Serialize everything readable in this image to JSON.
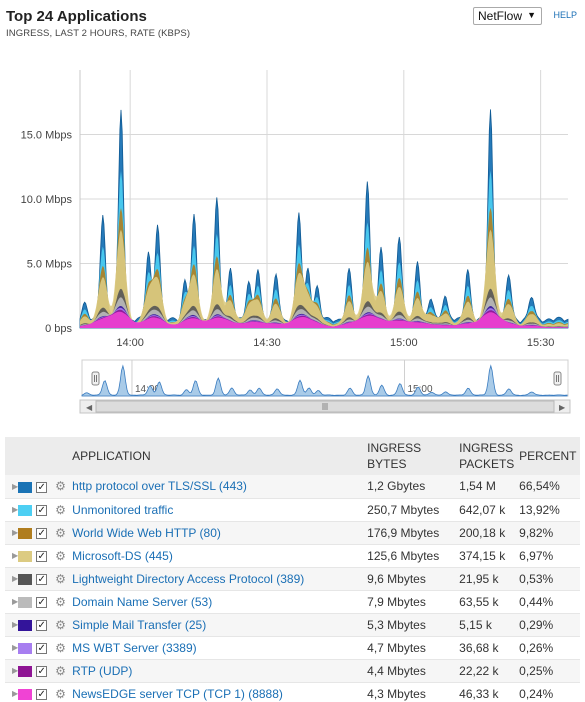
{
  "header": {
    "title": "Top 24 Applications",
    "subtitle": "INGRESS, LAST 2 HOURS, RATE (KBPS)",
    "help_label": "HELP",
    "source_select": {
      "value": "NetFlow"
    }
  },
  "chart_data": {
    "type": "area",
    "y_unit": "Mbps",
    "ylim": [
      0,
      20
    ],
    "y_ticks": [
      "0 bps",
      "5.0 Mbps",
      "10.0 Mbps",
      "15.0 Mbps"
    ],
    "x_ticks": [
      "14:00",
      "14:30",
      "15:00",
      "15:30"
    ],
    "x_range": [
      "13:49",
      "15:36"
    ],
    "grid": true,
    "spikes": [
      {
        "t": "13:50",
        "v": 1.2
      },
      {
        "t": "13:54",
        "v": 8.3
      },
      {
        "t": "13:58",
        "v": 16.2
      },
      {
        "t": "14:04",
        "v": 5.2
      },
      {
        "t": "14:06",
        "v": 7.5
      },
      {
        "t": "14:12",
        "v": 3.0
      },
      {
        "t": "14:14",
        "v": 8.0
      },
      {
        "t": "14:19",
        "v": 9.3
      },
      {
        "t": "14:22",
        "v": 4.0
      },
      {
        "t": "14:26",
        "v": 2.8
      },
      {
        "t": "14:28",
        "v": 4.0
      },
      {
        "t": "14:32",
        "v": 3.5
      },
      {
        "t": "14:37",
        "v": 8.3
      },
      {
        "t": "14:39",
        "v": 4.0
      },
      {
        "t": "14:41",
        "v": 2.5
      },
      {
        "t": "14:48",
        "v": 3.8
      },
      {
        "t": "14:52",
        "v": 10.8
      },
      {
        "t": "14:55",
        "v": 5.5
      },
      {
        "t": "14:59",
        "v": 6.5
      },
      {
        "t": "15:03",
        "v": 4.5
      },
      {
        "t": "15:06",
        "v": 1.6
      },
      {
        "t": "15:09",
        "v": 1.9
      },
      {
        "t": "15:14",
        "v": 4.0
      },
      {
        "t": "15:19",
        "v": 16.3
      },
      {
        "t": "15:23",
        "v": 3.5
      },
      {
        "t": "15:28",
        "v": 1.8
      }
    ]
  },
  "table": {
    "headers": {
      "application": "APPLICATION",
      "bytes": [
        "INGRESS",
        "BYTES"
      ],
      "packets": [
        "INGRESS",
        "PACKETS"
      ],
      "percent": "PERCENT"
    },
    "rows": [
      {
        "name": "http protocol over TLS/SSL (443)",
        "color": "#1a73b5",
        "bytes": "1,2 Gbytes",
        "packets": "1,54 M",
        "percent": "66,54%"
      },
      {
        "name": "Unmonitored traffic",
        "color": "#4dcff3",
        "bytes": "250,7 Mbytes",
        "packets": "642,07 k",
        "percent": "13,92%"
      },
      {
        "name": "World Wide Web HTTP (80)",
        "color": "#b07d1e",
        "bytes": "176,9 Mbytes",
        "packets": "200,18 k",
        "percent": "9,82%"
      },
      {
        "name": "Microsoft-DS (445)",
        "color": "#dccb82",
        "bytes": "125,6 Mbytes",
        "packets": "374,15 k",
        "percent": "6,97%"
      },
      {
        "name": "Lightweight Directory Access Protocol (389)",
        "color": "#555555",
        "bytes": "9,6 Mbytes",
        "packets": "21,95 k",
        "percent": "0,53%"
      },
      {
        "name": "Domain Name Server (53)",
        "color": "#bbbbbb",
        "bytes": "7,9 Mbytes",
        "packets": "63,55 k",
        "percent": "0,44%"
      },
      {
        "name": "Simple Mail Transfer (25)",
        "color": "#33149a",
        "bytes": "5,3 Mbytes",
        "packets": "5,15 k",
        "percent": "0,29%"
      },
      {
        "name": "MS WBT Server (3389)",
        "color": "#a77ef0",
        "bytes": "4,7 Mbytes",
        "packets": "36,68 k",
        "percent": "0,26%"
      },
      {
        "name": "RTP (UDP)",
        "color": "#8e1493",
        "bytes": "4,4 Mbytes",
        "packets": "22,22 k",
        "percent": "0,25%"
      },
      {
        "name": "NewsEDGE server TCP (TCP 1) (8888)",
        "color": "#f043d4",
        "bytes": "4,3 Mbytes",
        "packets": "46,33 k",
        "percent": "0,24%"
      }
    ]
  }
}
